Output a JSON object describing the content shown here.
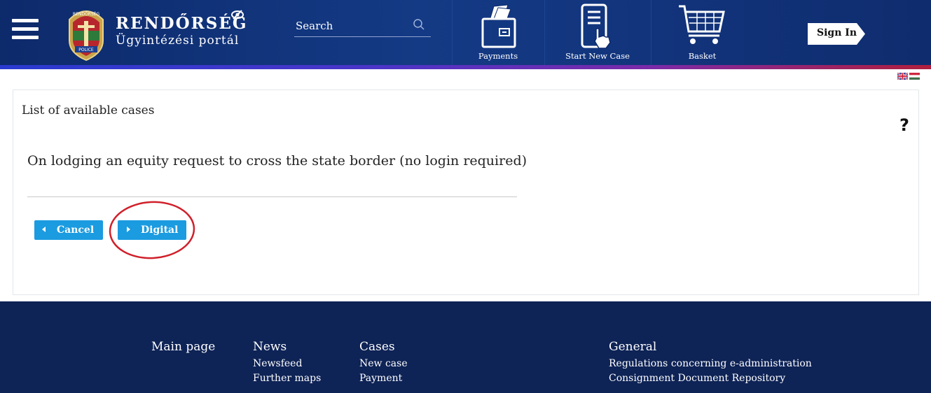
{
  "header": {
    "brand_title": "RENDŐRSÉG",
    "brand_subtitle": "Ügyintézési portál",
    "crest_text_top": "RENDŐRSÉG",
    "crest_text_bottom": "POLICE",
    "search": {
      "placeholder": "Search"
    },
    "nav": [
      {
        "label": "Payments",
        "icon": "wallet-icon"
      },
      {
        "label": "Start New Case",
        "icon": "start-case-icon"
      },
      {
        "label": "Basket",
        "icon": "basket-icon"
      }
    ],
    "signin_label": "Sign In"
  },
  "languages": [
    "en",
    "hu"
  ],
  "content": {
    "title": "List of available cases",
    "case_text": "On lodging an equity request to cross the state border (no login required)",
    "buttons": {
      "cancel": "Cancel",
      "digital": "Digital"
    }
  },
  "footer": {
    "main_page": "Main page",
    "news": {
      "heading": "News",
      "links": [
        "Newsfeed",
        "Further maps"
      ]
    },
    "cases": {
      "heading": "Cases",
      "links": [
        "New case",
        "Payment"
      ]
    },
    "general": {
      "heading": "General",
      "links": [
        "Regulations concerning e-administration",
        "Consignment Document Repository"
      ]
    }
  },
  "colors": {
    "header_bg": "#143a85",
    "button": "#1b9be0",
    "footer_bg": "#0e2356",
    "annotation": "#d0202a"
  }
}
